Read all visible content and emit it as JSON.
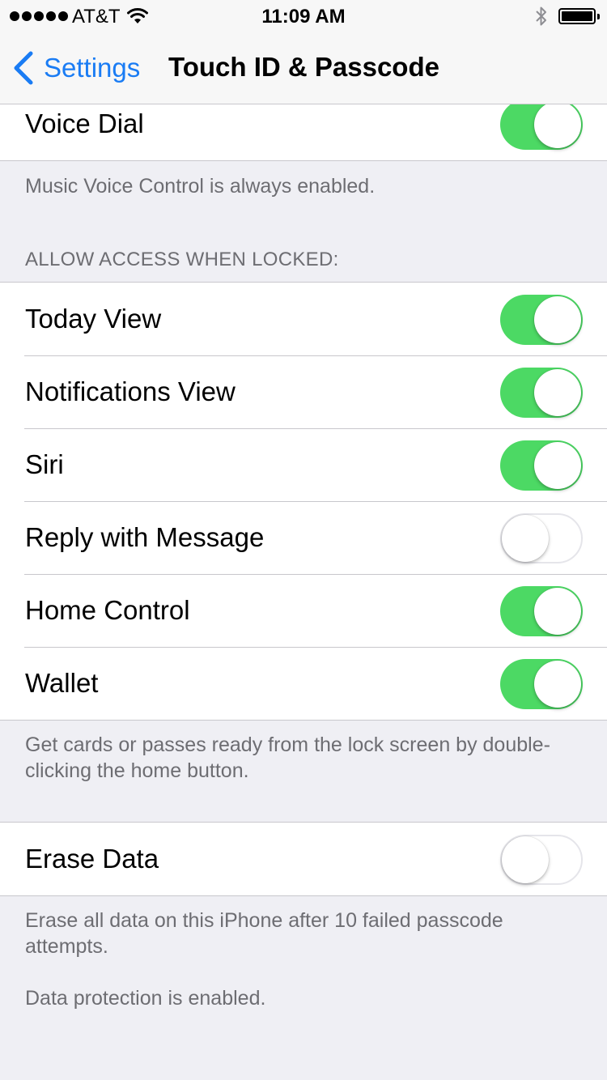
{
  "status_bar": {
    "carrier": "AT&T",
    "time": "11:09 AM",
    "icons": [
      "signal-dots-icon",
      "wifi-icon",
      "bluetooth-icon",
      "battery-icon"
    ]
  },
  "nav": {
    "back_label": "Settings",
    "title": "Touch ID & Passcode"
  },
  "colors": {
    "accent": "#1a7cf4",
    "toggle_on": "#4cd964",
    "background": "#efeff4"
  },
  "voice_section": {
    "rows": [
      {
        "label": "Voice Dial",
        "on": true
      }
    ],
    "footer": "Music Voice Control is always enabled."
  },
  "locked_section": {
    "header": "ALLOW ACCESS WHEN LOCKED:",
    "rows": [
      {
        "label": "Today View",
        "on": true
      },
      {
        "label": "Notifications View",
        "on": true
      },
      {
        "label": "Siri",
        "on": true
      },
      {
        "label": "Reply with Message",
        "on": false
      },
      {
        "label": "Home Control",
        "on": true
      },
      {
        "label": "Wallet",
        "on": true
      }
    ],
    "footer": "Get cards or passes ready from the lock screen by double-clicking the home button."
  },
  "erase_section": {
    "rows": [
      {
        "label": "Erase Data",
        "on": false
      }
    ],
    "footer_1": "Erase all data on this iPhone after 10 failed passcode attempts.",
    "footer_2": "Data protection is enabled."
  }
}
